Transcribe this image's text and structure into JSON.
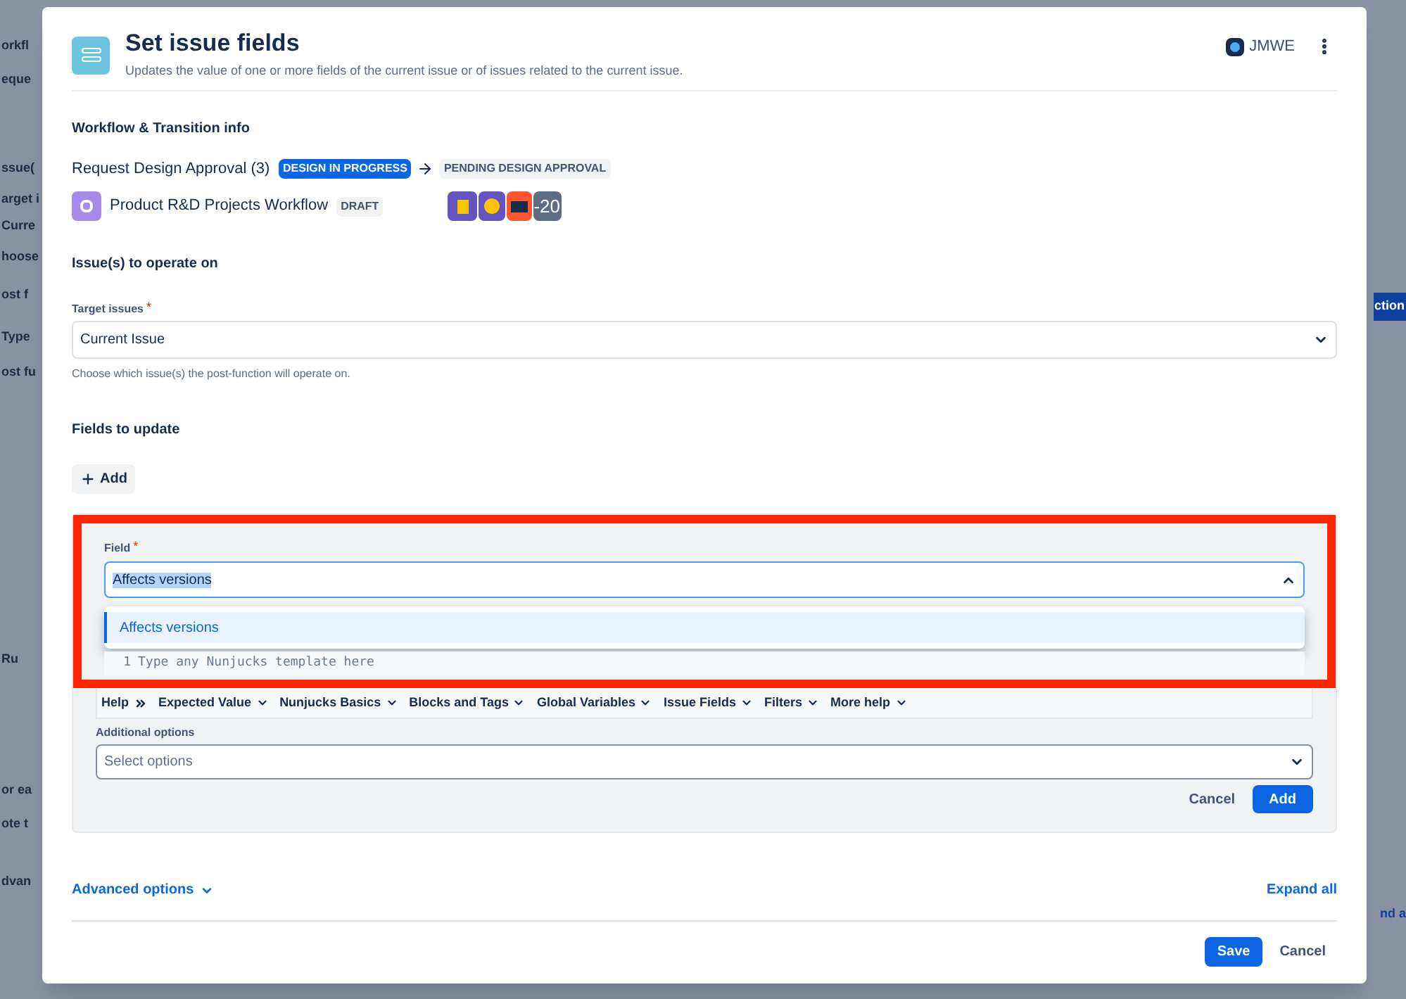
{
  "background": {
    "left_fragments": [
      "orkfl",
      "eque",
      "ssue(",
      "arget i",
      "Curre",
      "hoose",
      "ost f",
      "Type",
      "ost fu",
      "Ru",
      "or ea",
      "ote t",
      "dvan"
    ],
    "right_fragments": [
      "ction",
      "nd a"
    ]
  },
  "dialog": {
    "title": "Set issue fields",
    "subtitle": "Updates the value of one or more fields of the current issue or of issues related to the current issue.",
    "vendor": "JMWE"
  },
  "workflow_info": {
    "heading": "Workflow & Transition info",
    "transition": "Request Design Approval (3)",
    "from_status": "DESIGN IN PROGRESS",
    "to_status": "PENDING DESIGN APPROVAL",
    "workflow": "Product R&D Projects Workflow",
    "workflow_badge": "DRAFT",
    "more_apps_count": "-20"
  },
  "issues": {
    "heading": "Issue(s) to operate on",
    "target_label": "Target issues",
    "target_required_mark": "*",
    "target_value": "Current Issue",
    "help": "Choose which issue(s) the post-function will operate on."
  },
  "fields": {
    "heading": "Fields to update",
    "add_button": "Add"
  },
  "field_editor": {
    "highlighted": true,
    "field_label": "Field",
    "field_required_mark": "*",
    "field_value": "Affects versions",
    "dropdown_open": true,
    "options": [
      {
        "label": "Affects versions",
        "selected": true
      }
    ],
    "line_number": "1",
    "template_placeholder": "Type any Nunjucks template here",
    "help_label": "Help",
    "help_menus": [
      "Expected Value",
      "Nunjucks Basics",
      "Blocks and Tags",
      "Global Variables",
      "Issue Fields",
      "Filters",
      "More help"
    ],
    "additional_label": "Additional options",
    "additional_placeholder": "Select options",
    "cancel_button": "Cancel",
    "add_button": "Add"
  },
  "footer": {
    "advanced_options": "Advanced options",
    "expand_all": "Expand all",
    "save_button": "Save",
    "cancel_button": "Cancel"
  }
}
